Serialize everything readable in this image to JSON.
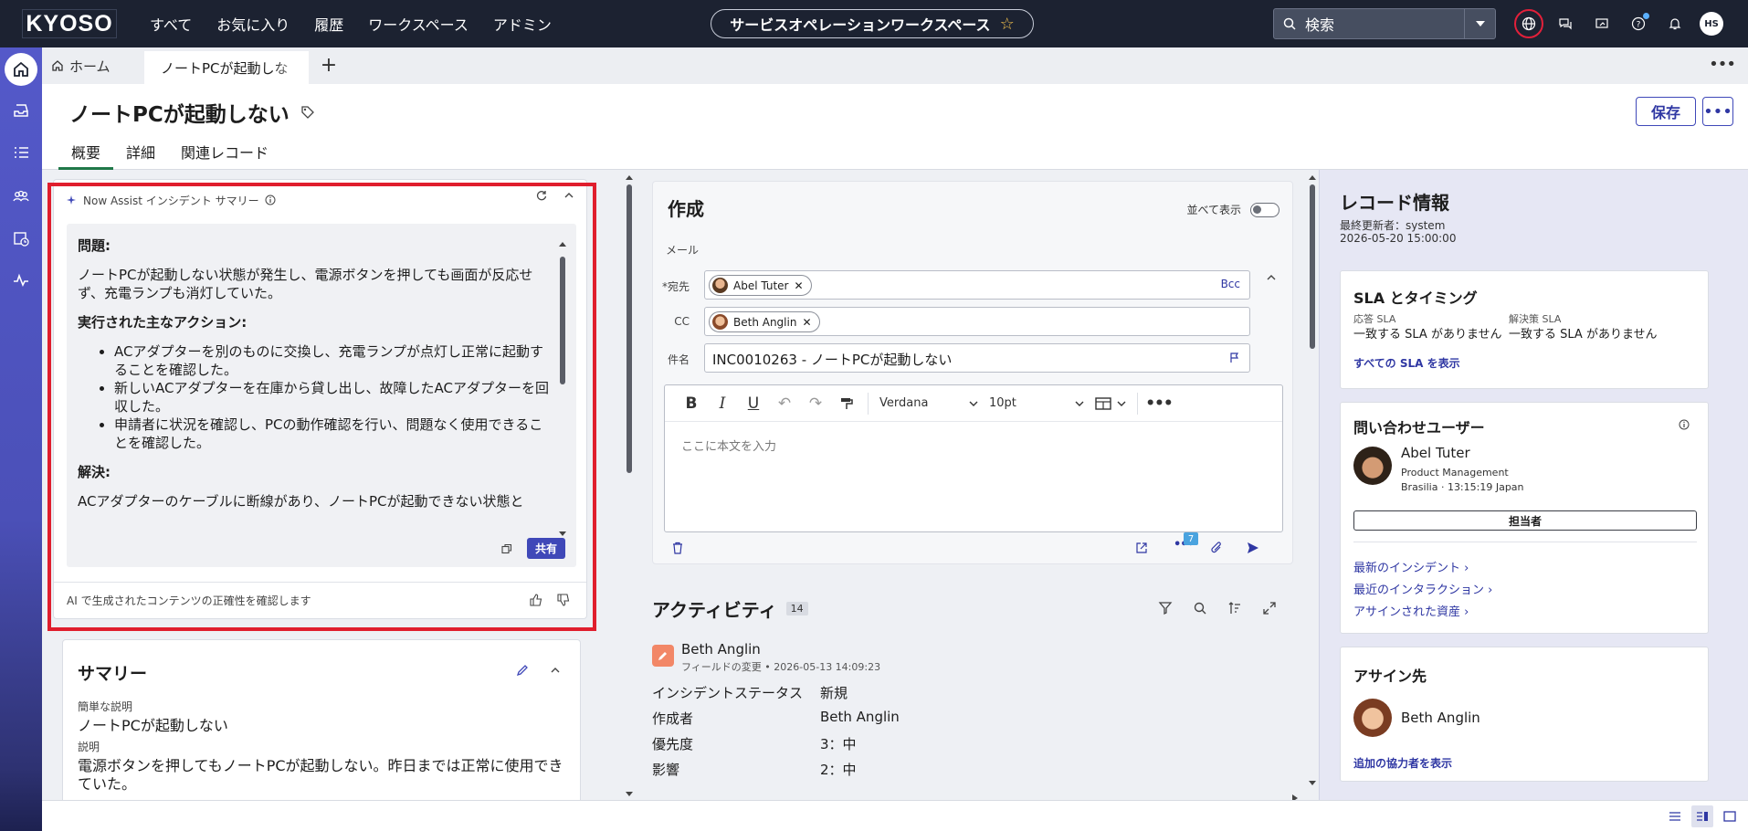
{
  "topbar": {
    "logo": "KYOSO",
    "nav": [
      "すべて",
      "お気に入り",
      "履歴",
      "ワークスペース",
      "アドミン"
    ],
    "workspace": "サービスオペレーションワークスペース",
    "search_placeholder": "検索",
    "user_initials": "HS"
  },
  "tabs": {
    "home": "ホーム",
    "active": "ノートPCが起動しな"
  },
  "record": {
    "title": "ノートPCが起動しない",
    "save": "保存",
    "subtabs": [
      "概要",
      "詳細",
      "関連レコード"
    ]
  },
  "now_assist": {
    "header": "Now Assist インシデント サマリー",
    "problem_heading": "問題:",
    "problem_text": "ノートPCが起動しない状態が発生し、電源ボタンを押しても画面が反応せず、充電ランプも消灯していた。",
    "actions_heading": "実行された主なアクション:",
    "actions": [
      "ACアダプターを別のものに交換し、充電ランプが点灯し正常に起動することを確認した。",
      "新しいACアダプターを在庫から貸し出し、故障したACアダプターを回収した。",
      "申請者に状況を確認し、PCの動作確認を行い、問題なく使用できることを確認した。"
    ],
    "resolution_heading": "解決:",
    "resolution_text": "ACアダプターのケーブルに断線があり、ノートPCが起動できない状態と",
    "share": "共有",
    "footer": "AI で生成されたコンテンツの正確性を確認します"
  },
  "summary": {
    "title": "サマリー",
    "short_desc_label": "簡単な説明",
    "short_desc": "ノートPCが起動しない",
    "desc_label": "説明",
    "desc": "電源ボタンを押してもノートPCが起動しない。昨日までは正常に使用できていた。"
  },
  "compose": {
    "title": "作成",
    "side_by_side": "並べて表示",
    "mail_label": "メール",
    "to_label": "宛先",
    "to_chip": "Abel Tuter",
    "bcc": "Bcc",
    "cc_label": "CC",
    "cc_chip": "Beth Anglin",
    "subject_label": "件名",
    "subject": "INC0010263 - ノートPCが起動しない",
    "font": "Verdana",
    "size": "10pt",
    "placeholder": "ここに本文を入力",
    "more_badge": "7"
  },
  "activity": {
    "title": "アクティビティ",
    "count": "14",
    "author": "Beth Anglin",
    "meta": "フィールドの変更 • 2026-05-13 14:09:23",
    "rows": [
      {
        "k": "インシデントステータス",
        "v": "新規"
      },
      {
        "k": "作成者",
        "v": "Beth Anglin"
      },
      {
        "k": "優先度",
        "v": "3：中"
      },
      {
        "k": "影響",
        "v": "2：中"
      }
    ]
  },
  "record_info": {
    "title": "レコード情報",
    "updated_by": "最終更新者：system",
    "updated_at": "2026-05-20 15:00:00",
    "sla": {
      "title": "SLA とタイミング",
      "response_label": "応答 SLA",
      "response_value": "一致する SLA がありません",
      "resolution_label": "解決策 SLA",
      "resolution_value": "一致する SLA がありません",
      "link": "すべての SLA を表示"
    },
    "caller": {
      "title": "問い合わせユーザー",
      "name": "Abel Tuter",
      "dept": "Product Management",
      "location": "Brasilia · 13:15:19 Japan",
      "assign_button": "担当者",
      "links": [
        "最新のインシデント",
        "最近のインタラクション",
        "アサインされた資産"
      ]
    },
    "assignee": {
      "title": "アサイン先",
      "name": "Beth Anglin",
      "link": "追加の協力者を表示"
    }
  }
}
